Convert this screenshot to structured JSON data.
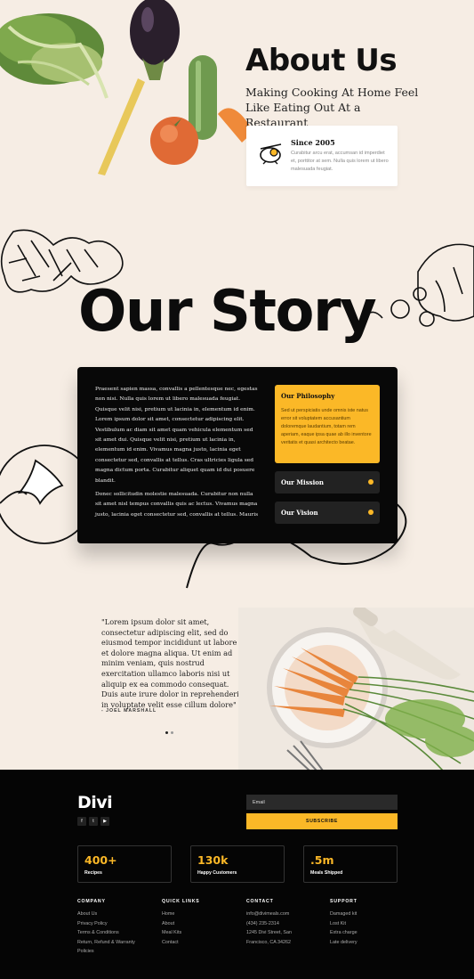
{
  "hero": {
    "title": "About Us",
    "subtitle": "Making Cooking At Home Feel Like Eating Out At a Restaurant",
    "card_title": "Since 2005",
    "card_text": "Curabitur arcu erat, accumsan id imperdiet et, porttitor at sem. Nulla quis lorem ut libero malesuada feugiat."
  },
  "story": {
    "title": "Our Story",
    "paragraph1": "Praesent sapien massa, convallis a pellentesque nec, egestas non nisi. Nulla quis lorem ut libero malesuada feugiat. Quisque velit nisi, pretium ut lacinia in, elementum id enim. Lorem ipsum dolor sit amet, consectetur adipiscing elit. Vestibulum ac diam sit amet quam vehicula elementum sed sit amet dui. Quisque velit nisi, pretium ut lacinia in, elementum id enim. Vivamus magna justo, lacinia eget consectetur sed, convallis at tellus. Cras ultricies ligula sed magna dictum porta. Curabitur aliquet quam id dui posuere blandit.",
    "paragraph2": "Donec sollicitudin molestie malesuada. Curabitur non nulla sit amet nisl tempus convallis quis ac lectus. Vivamus magna justo, lacinia eget consectetur sed, convallis at tellus. Mauris",
    "philosophy_title": "Our Philosophy",
    "philosophy_text": "Sed ut perspiciatis unde omnis iste natus error sit voluptatem accusantium doloremque laudantium, totam rem aperiam, eaque ipsa quae ab illo inventore veritatis et quasi architecto beatae.",
    "mission_label": "Our Mission",
    "vision_label": "Our Vision"
  },
  "testimonial": {
    "quote": "\"Lorem ipsum dolor sit amet, consectetur adipiscing elit, sed do eiusmod tempor incididunt ut labore et dolore magna aliqua. Ut enim ad minim veniam, quis nostrud exercitation ullamco laboris nisi ut aliquip ex ea commodo consequat. Duis aute irure dolor in reprehenderit in voluptate velit esse cillum dolore\"",
    "author": "- JOEL MARSHALL"
  },
  "footer": {
    "logo": "Divi",
    "social": [
      {
        "icon": "facebook-icon",
        "glyph": "f"
      },
      {
        "icon": "twitter-icon",
        "glyph": "t"
      },
      {
        "icon": "youtube-icon",
        "glyph": "▶"
      }
    ],
    "email_placeholder": "Email",
    "subscribe_label": "SUBSCRIBE",
    "stats": [
      {
        "value": "400+",
        "label": "Recipes"
      },
      {
        "value": "130k",
        "label": "Happy Customers"
      },
      {
        "value": ".5m",
        "label": "Meals Shipped"
      }
    ],
    "columns": [
      {
        "heading": "COMPANY",
        "items": [
          "About Us",
          "Privacy Policy",
          "Terms & Conditions",
          "Return, Refund & Warranty Policies"
        ]
      },
      {
        "heading": "QUICK LINKS",
        "items": [
          "Home",
          "About",
          "Meal Kits",
          "Contact"
        ]
      },
      {
        "heading": "CONTACT",
        "items": [
          "info@divimeals.com",
          "(434) 235-2314",
          "1245 Divi Street, San Francisco, CA 34262"
        ]
      },
      {
        "heading": "SUPPORT",
        "items": [
          "Damaged kit",
          "Lost Kit",
          "Extra charge",
          "Late delivery"
        ]
      }
    ]
  },
  "colors": {
    "accent": "#fbb827",
    "background": "#f6ede4",
    "dark": "#080808"
  }
}
